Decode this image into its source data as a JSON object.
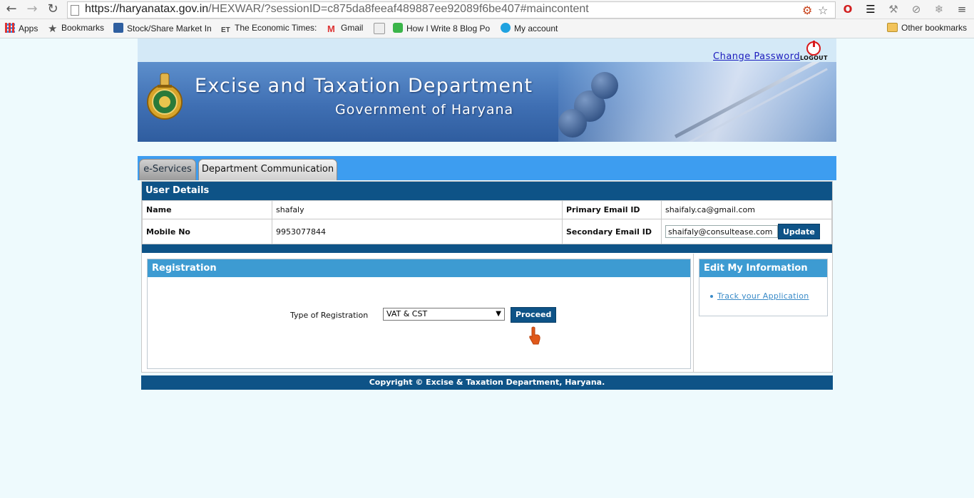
{
  "browser": {
    "url_host": "https://haryanatax.gov.in",
    "url_path": "/HEXWAR/?sessionID=c875da8feeaf489887ee92089f6be407#maincontent",
    "bookmarks": [
      {
        "label": "Apps",
        "icon": "apps-grid-icon"
      },
      {
        "label": "Bookmarks",
        "icon": "star-icon"
      },
      {
        "label": "Stock/Share Market In",
        "icon": "stock-icon"
      },
      {
        "label": "The Economic Times:",
        "icon": "et-icon"
      },
      {
        "label": "Gmail",
        "icon": "gmail-icon"
      },
      {
        "label": "",
        "icon": "site-icon"
      },
      {
        "label": "How I Write 8 Blog Po",
        "icon": "q-icon"
      },
      {
        "label": "My account",
        "icon": "skype-icon"
      }
    ],
    "other_bookmarks": "Other bookmarks"
  },
  "header": {
    "change_password": "Change Password",
    "logout": "LOGOUT",
    "title": "Excise and Taxation Department",
    "subtitle": "Government of Haryana"
  },
  "tabs": [
    {
      "label": "e-Services",
      "active": true
    },
    {
      "label": "Department Communication",
      "active": false
    }
  ],
  "user_details": {
    "heading": "User Details",
    "name_label": "Name",
    "name_value": "shafaly",
    "primary_email_label": "Primary Email ID",
    "primary_email_value": "shaifaly.ca@gmail.com",
    "mobile_label": "Mobile No",
    "mobile_value": "9953077844",
    "secondary_email_label": "Secondary Email ID",
    "secondary_email_value": "shaifaly@consultease.com",
    "update_label": "Update"
  },
  "registration": {
    "heading": "Registration",
    "type_label": "Type of Registration",
    "selected": "VAT & CST",
    "proceed_label": "Proceed"
  },
  "edit_info": {
    "heading": "Edit My Information",
    "link": "Track your Application"
  },
  "footer": "Copyright © Excise & Taxation Department, Haryana.",
  "colors": {
    "primary": "#0e5387",
    "accent": "#3d9bd2",
    "tabbar": "#3d9df0"
  }
}
